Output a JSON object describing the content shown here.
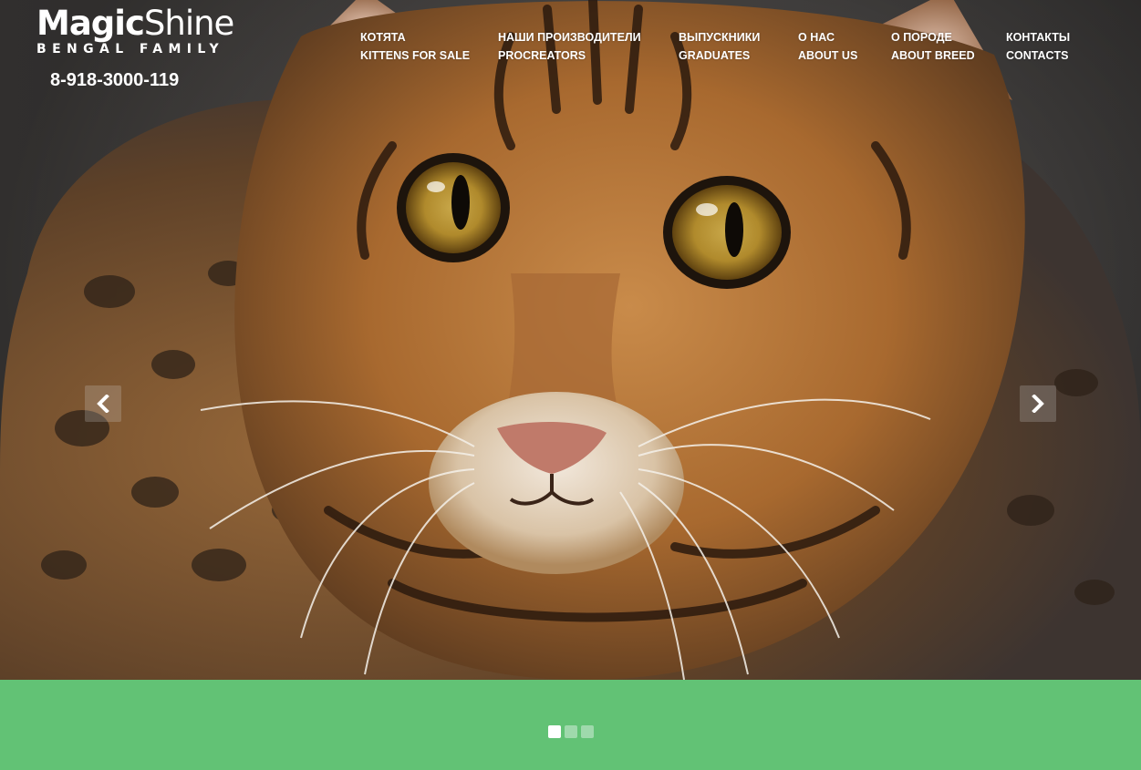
{
  "brand": {
    "name_bold": "Magic",
    "name_light": "Shine",
    "tagline": "BENGAL FAMILY",
    "phone": "8-918-3000-119"
  },
  "nav": {
    "items": [
      {
        "ru": "КОТЯТА",
        "en": "KITTENS FOR SALE"
      },
      {
        "ru": "НАШИ ПРОИЗВОДИТЕЛИ",
        "en": "PROCREATORS"
      },
      {
        "ru": "ВЫПУСКНИКИ",
        "en": "GRADUATES"
      },
      {
        "ru": "О НАС",
        "en": "ABOUT US"
      },
      {
        "ru": "О ПОРОДЕ",
        "en": "ABOUT BREED"
      },
      {
        "ru": "КОНТАКТЫ",
        "en": "CONTACTS"
      }
    ]
  },
  "slider": {
    "slide_count": 3,
    "active_slide": 1,
    "prev_icon": "chevron-left-icon",
    "next_icon": "chevron-right-icon"
  },
  "colors": {
    "footer_band": "#62c275",
    "dot_active": "#ffffff",
    "dot_inactive": "#9fd9ac",
    "text": "#ffffff"
  }
}
